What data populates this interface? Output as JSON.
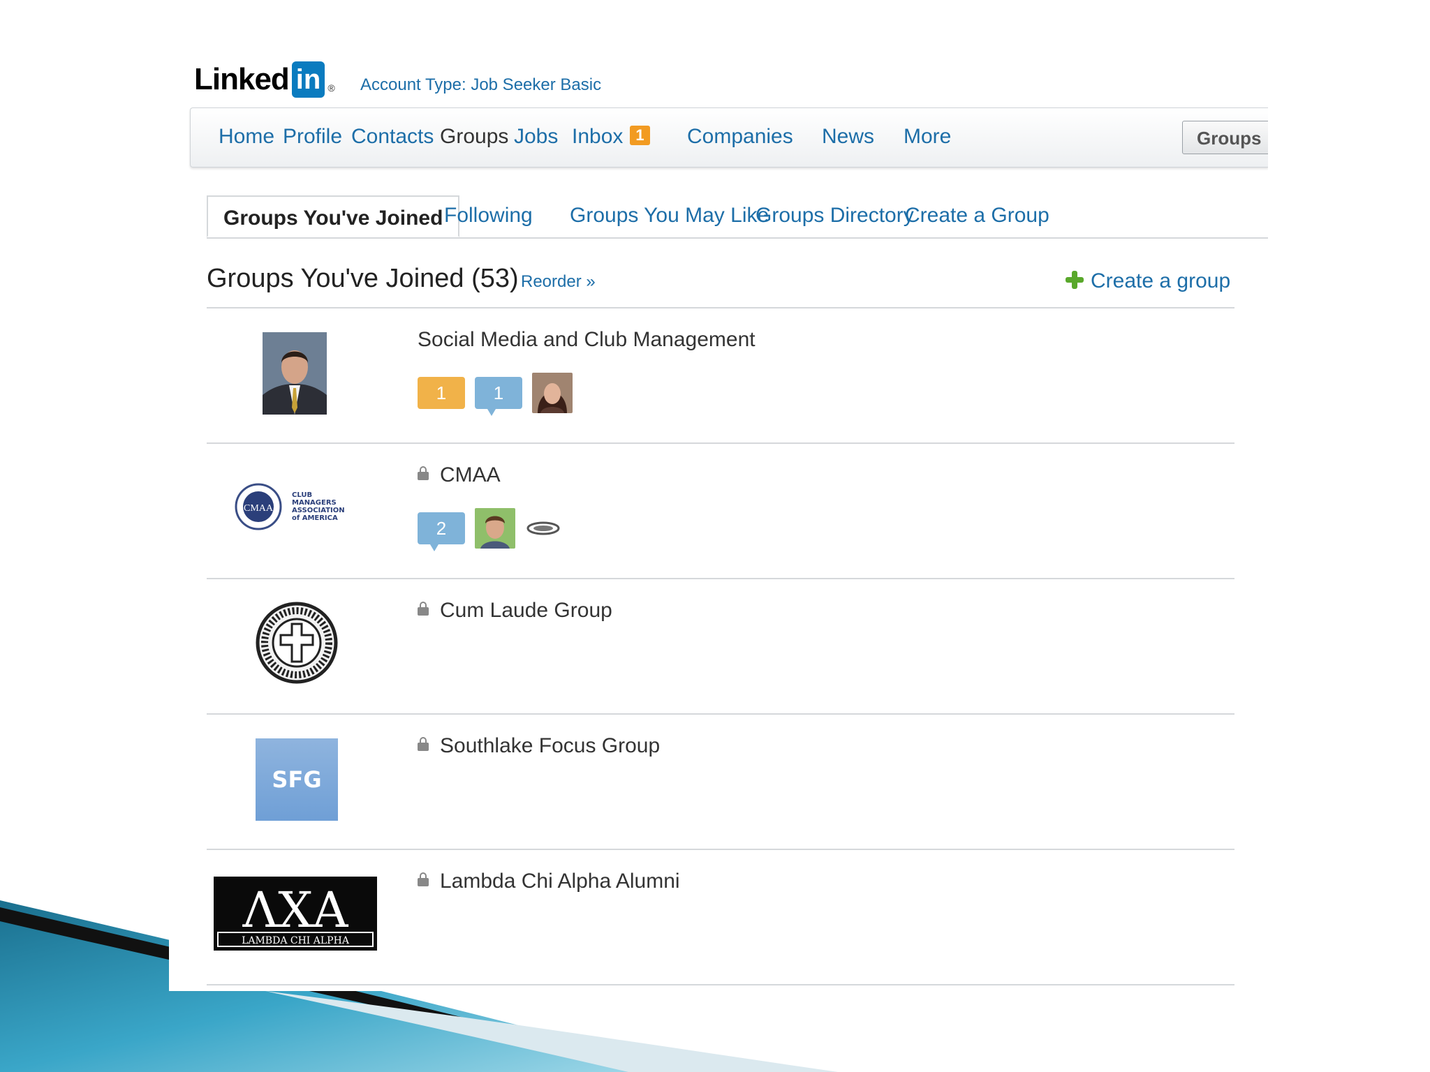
{
  "header": {
    "logo_word": "Linked",
    "logo_in": "in",
    "logo_mark": "®",
    "account_type": "Account Type: Job Seeker Basic"
  },
  "nav": {
    "items": [
      "Home",
      "Profile",
      "Contacts",
      "Groups",
      "Jobs",
      "Inbox",
      "Companies",
      "News",
      "More"
    ],
    "inbox_badge": "1",
    "search_button": "Groups"
  },
  "tabs": [
    "Groups You've Joined",
    "Following",
    "Groups You May Like",
    "Groups Directory",
    "Create a Group"
  ],
  "section": {
    "title": "Groups You've Joined (53)",
    "reorder": "Reorder »",
    "create_group": "Create a group"
  },
  "groups": [
    {
      "name": "Social Media and Club Management",
      "locked": false,
      "new_count": "1",
      "discussion_count": "1"
    },
    {
      "name": "CMAA",
      "locked": true,
      "discussion_count": "2",
      "logo_text": [
        "CLUB",
        "MANAGERS",
        "ASSOCIATION",
        "of AMERICA"
      ],
      "logo_mark": "CMAA"
    },
    {
      "name": "Cum Laude Group",
      "locked": true
    },
    {
      "name": "Southlake Focus Group",
      "locked": true,
      "logo_text": "SFG"
    },
    {
      "name": "Lambda Chi Alpha Alumni",
      "locked": true,
      "logo_letters": "ΛΧΑ",
      "logo_subtitle": "LAMBDA CHI ALPHA"
    }
  ],
  "colors": {
    "link": "#1d6ea8",
    "badge_orange": "#f29b22",
    "linkedin_blue": "#0a7bbf"
  }
}
